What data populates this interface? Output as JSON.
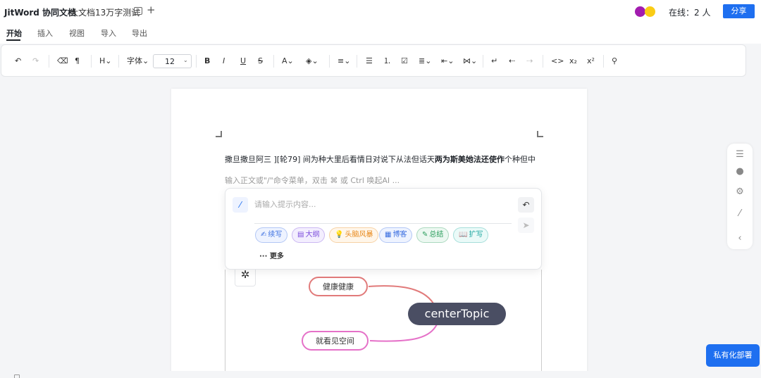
{
  "header": {
    "app_title": "JitWord 协同文档",
    "doc_title": "大文档13万字测试",
    "online_text": "在线：2 人",
    "share_label": "分享",
    "avatar_colors": [
      "#a21caf",
      "#facc15"
    ]
  },
  "menu": {
    "items": [
      "开始",
      "插入",
      "视图",
      "导入",
      "导出"
    ],
    "active": "开始"
  },
  "toolbar": {
    "undo": "↶",
    "redo": "↷",
    "eraser": "⌫",
    "format_painter": "¶",
    "heading": "H⌄",
    "font_family": "字体⌄",
    "font_size": "12",
    "bold": "B",
    "italic": "I",
    "underline": "U",
    "strike": "S",
    "font_color": "A⌄",
    "highlight": "◈⌄",
    "align": "≡⌄",
    "bullet_list": "☰",
    "ordered_list": "⒈",
    "task_list": "☑",
    "line_height": "≣⌄",
    "indent": "⇤⌄",
    "columns": "⋈⌄",
    "wrap": "↵",
    "outdent": "⇠",
    "indent_right": "⇢",
    "code": "<>",
    "subscript": "x₂",
    "superscript": "x²",
    "search": "⚲"
  },
  "document": {
    "body_normal": "撒旦撒旦阿三 ][轮79] 间为种大里后看情日对说下从法但话天",
    "body_bold": "两为斯美她法还使作",
    "body_tail": "个种但中",
    "editor_placeholder": "输入正文或\"/\"命令菜单，双击 ⌘ 或 Ctrl 唤起AI ..."
  },
  "ai_panel": {
    "placeholder": "请输入提示内容...",
    "chips": [
      {
        "icon": "✍",
        "label": "续写",
        "color": "#3b6fe0",
        "bg": "#eef3ff"
      },
      {
        "icon": "▤",
        "label": "大纲",
        "color": "#7c4ddc",
        "bg": "#f3eefe"
      },
      {
        "icon": "💡",
        "label": "头脑风暴",
        "color": "#e8891c",
        "bg": "#fff6ea"
      },
      {
        "icon": "▦",
        "label": "博客",
        "color": "#3b6fe0",
        "bg": "#eef3ff"
      },
      {
        "icon": "✎",
        "label": "总结",
        "color": "#2a9d5c",
        "bg": "#ecf8f1"
      },
      {
        "icon": "📖",
        "label": "扩写",
        "color": "#1ea7a0",
        "bg": "#eafaf8"
      }
    ],
    "more_label": "··· 更多"
  },
  "mindmap": {
    "center": "centerTopic",
    "nodes": [
      "健康健康",
      "就看见空间"
    ],
    "colors": {
      "node1": "#e17a7a",
      "node2": "#e571c8",
      "center_bg": "#4a4e63"
    }
  },
  "right_rail": {
    "icons": [
      "menu-icon",
      "info-icon",
      "settings-icon",
      "wand-icon",
      "collapse-icon"
    ]
  },
  "private_deploy_label": "私有化部署"
}
